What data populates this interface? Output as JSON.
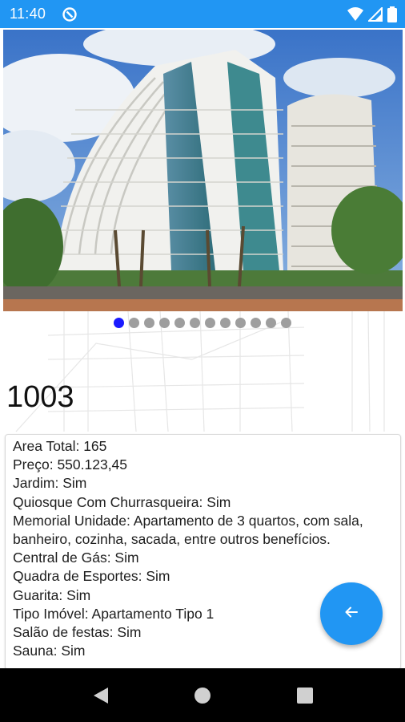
{
  "status_bar": {
    "time": "11:40"
  },
  "gallery": {
    "dot_count": 12,
    "active_index": 0
  },
  "unit": {
    "title": "1003"
  },
  "details": [
    "Area Total: 165",
    "Preço: 550.123,45",
    "Jardim: Sim",
    "Quiosque Com Churrasqueira: Sim",
    "Memorial Unidade: Apartamento de 3 quartos, com sala, banheiro, cozinha, sacada, entre outros benefícios.",
    "Central de Gás: Sim",
    "Quadra de Esportes: Sim",
    "Guarita: Sim",
    "Tipo Imóvel: Apartamento Tipo 1",
    "Salão de festas: Sim",
    "Sauna: Sim"
  ],
  "colors": {
    "primary": "#2196f3",
    "active_dot": "#1a1aff",
    "inactive_dot": "#9e9e9e"
  },
  "icons": {
    "fab": "arrow-left-icon",
    "nav": [
      "back-triangle-icon",
      "home-circle-icon",
      "recents-square-icon"
    ]
  }
}
